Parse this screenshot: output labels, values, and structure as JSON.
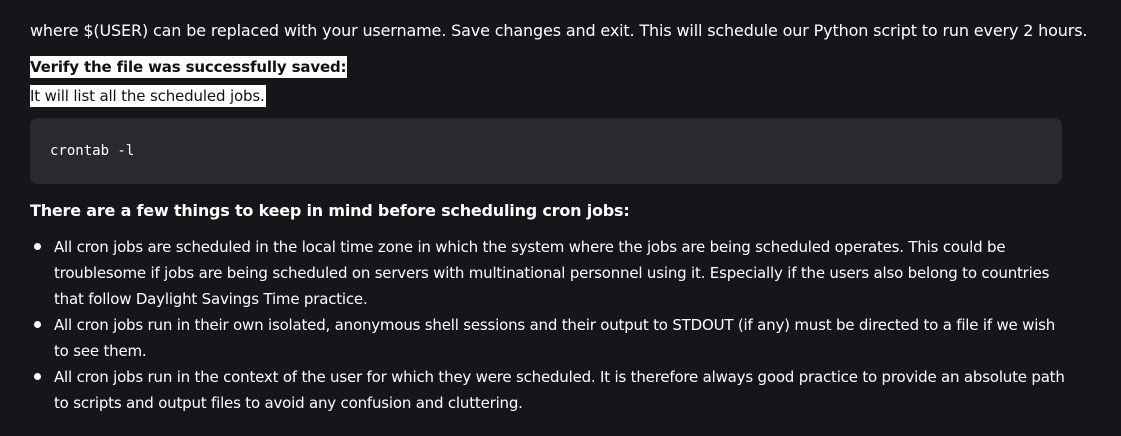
{
  "intro": "where $(USER) can be replaced with your username. Save changes and exit. This will schedule our Python script to run every 2 hours.",
  "verify_label": "Verify the file was successfully saved:",
  "list_note": "It will list all the scheduled jobs.",
  "code": "crontab -l",
  "heading": "There are a few things to keep in mind before scheduling cron jobs:",
  "bullets": [
    "All cron jobs are scheduled in the local time zone in which the system where the jobs are being scheduled operates. This could be troublesome if jobs are being scheduled on servers with multinational personnel using it. Especially if the users also belong to countries that follow Daylight Savings Time practice.",
    "All cron jobs run in their own isolated, anonymous shell sessions and their output to STDOUT (if any) must be directed to a file if we wish to see them.",
    "All cron jobs run in the context of the user for which they were scheduled. It is therefore always good practice to provide an absolute path to scripts and output files to avoid any confusion and cluttering."
  ]
}
